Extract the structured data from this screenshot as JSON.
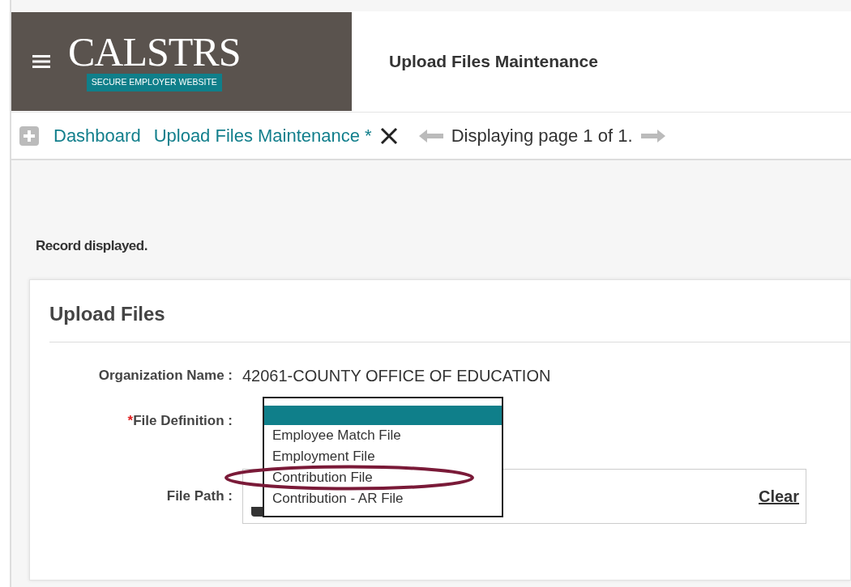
{
  "header": {
    "logo": {
      "name": "CALSTRS",
      "tagline": "SECURE EMPLOYER WEBSITE"
    },
    "title": "Upload Files Maintenance"
  },
  "breadcrumbs": [
    {
      "label": "Dashboard"
    },
    {
      "label": "Upload Files Maintenance *"
    }
  ],
  "pager": {
    "text": "Displaying page 1 of 1."
  },
  "message": "Record displayed.",
  "form": {
    "title": "Upload Files",
    "organization": {
      "label": "Organization Name :",
      "value": "42061-COUNTY OFFICE OF EDUCATION"
    },
    "file_definition": {
      "label": "File Definition :",
      "required_mark": "*",
      "options": [
        {
          "selected": true
        },
        {
          "label": "Employee Match File",
          "selected": false
        },
        {
          "label": "Employment File",
          "selected": false
        },
        {
          "label": "Contribution File",
          "selected": false,
          "circled": true
        },
        {
          "label": "Contribution - AR File",
          "selected": false
        }
      ]
    },
    "file_path": {
      "label": "File Path :",
      "clear": "Clear"
    }
  }
}
